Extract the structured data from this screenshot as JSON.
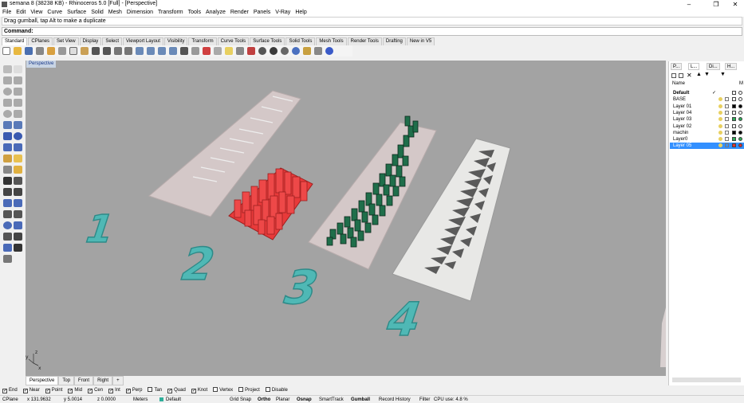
{
  "window": {
    "title": "semana 8 (38238 KB) - Rhinoceros 5.0 [Full] - [Perspective]",
    "minimize": "–",
    "maximize": "❐",
    "close": "✕"
  },
  "menu": [
    "File",
    "Edit",
    "View",
    "Curve",
    "Surface",
    "Solid",
    "Mesh",
    "Dimension",
    "Transform",
    "Tools",
    "Analyze",
    "Render",
    "Panels",
    "V-Ray",
    "Help"
  ],
  "command_history": "Drag gumball, tap Alt to make a duplicate",
  "command_prompt": "Command:",
  "toolbar_tabs": [
    "Standard",
    "CPlanes",
    "Set View",
    "Display",
    "Select",
    "Viewport Layout",
    "Visibility",
    "Transform",
    "Curve Tools",
    "Surface Tools",
    "Solid Tools",
    "Mesh Tools",
    "Render Tools",
    "Drafting",
    "New in V5"
  ],
  "viewport": {
    "title": "Perspective",
    "labels": [
      "1",
      "2",
      "3",
      "4"
    ],
    "axis_y": "y",
    "axis_z": "z",
    "axis_x": "x"
  },
  "view_tabs": [
    "Perspective",
    "Top",
    "Front",
    "Right",
    "+"
  ],
  "osnaps": [
    {
      "label": "End",
      "checked": true
    },
    {
      "label": "Near",
      "checked": true
    },
    {
      "label": "Point",
      "checked": true
    },
    {
      "label": "Mid",
      "checked": true
    },
    {
      "label": "Cen",
      "checked": true
    },
    {
      "label": "Int",
      "checked": true
    },
    {
      "label": "Perp",
      "checked": true
    },
    {
      "label": "Tan",
      "checked": false
    },
    {
      "label": "Quad",
      "checked": true
    },
    {
      "label": "Knot",
      "checked": true
    },
    {
      "label": "Vertex",
      "checked": false
    },
    {
      "label": "Project",
      "checked": false
    },
    {
      "label": "Disable",
      "checked": false
    }
  ],
  "status": {
    "cplane": "CPlane",
    "x": "x 131.9632",
    "y": "y 5.0014",
    "z": "z 0.0000",
    "units": "Meters",
    "layer": "Default",
    "grid_snap": "Grid Snap",
    "ortho": "Ortho",
    "planar": "Planar",
    "osnap": "Osnap",
    "smarttrack": "SmartTrack",
    "gumball": "Gumball",
    "record_history": "Record History",
    "filter": "Filter",
    "cpu": "CPU use: 4.8 %"
  },
  "panel": {
    "tabs": [
      "P...",
      "L...",
      "Di...",
      "H..."
    ],
    "name_header": "Name",
    "mat_header": "M",
    "layers": [
      {
        "name": "Default",
        "bold": true,
        "check": "✓",
        "color": "#ffffff"
      },
      {
        "name": "BASE",
        "color": "#ffffff"
      },
      {
        "name": "Layer 01",
        "color": "#000000"
      },
      {
        "name": "Layer 04",
        "color": "#ffffff"
      },
      {
        "name": "Layer 03",
        "color": "#2fae5a"
      },
      {
        "name": "Layer 02",
        "color": "#ffffff"
      },
      {
        "name": "machin",
        "color": "#000000"
      },
      {
        "name": "Layer0",
        "color": "#2fae5a"
      },
      {
        "name": "Layer 05",
        "color": "#e53030",
        "selected": true
      }
    ]
  },
  "colors": {
    "viewport_bg": "#a3a3a3",
    "cyan_numbers": "#4fb8b5",
    "red_blocks": "#e83a3a",
    "green_blocks": "#1f6e4a",
    "slab": "#d4c8c8"
  }
}
